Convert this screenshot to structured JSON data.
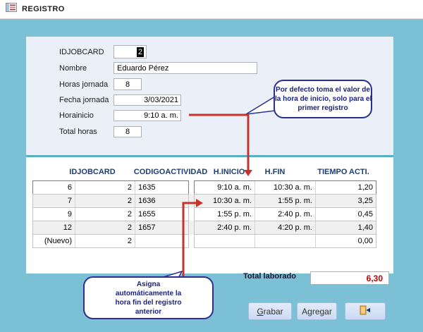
{
  "titlebar": {
    "title": "REGISTRO"
  },
  "form": {
    "fields": [
      {
        "label": "IDJOBCARD",
        "value": "2"
      },
      {
        "label": "Nombre",
        "value": "Eduardo Pérez"
      },
      {
        "label": "Horas jornada",
        "value": "8"
      },
      {
        "label": "Fecha jornada",
        "value": "3/03/2021"
      },
      {
        "label": "Horainicio",
        "value": "9:10 a. m."
      },
      {
        "label": "Total horas",
        "value": "8"
      }
    ]
  },
  "table": {
    "headers": [
      "IDJOBCARD",
      "CODIGOACTIVIDAD",
      "H.INICIO",
      "H.FIN",
      "TIEMPO ACTI."
    ],
    "rows": [
      [
        "6",
        "2",
        "1635",
        "9:10 a. m.",
        "10:30 a. m.",
        "1,20"
      ],
      [
        "7",
        "2",
        "1636",
        "10:30 a. m.",
        "1:55 p. m.",
        "3,25"
      ],
      [
        "9",
        "2",
        "1655",
        "1:55 p. m.",
        "2:40 p. m.",
        "0,45"
      ],
      [
        "12",
        "2",
        "1657",
        "2:40 p. m.",
        "4:20 p. m.",
        "1,40"
      ],
      [
        "(Nuevo)",
        "2",
        "",
        "",
        "",
        "0,00"
      ]
    ]
  },
  "callouts": {
    "top": {
      "lines": [
        "Por defecto toma el valor de",
        "la hora de inicio, solo para el",
        "primer registro"
      ]
    },
    "bottom": {
      "lines": [
        "Asigna",
        "automáticamente la",
        "hora fin del registro",
        "anterior"
      ]
    }
  },
  "footer": {
    "total_label": "Total laborado",
    "total_value": "6,30",
    "buttons": {
      "grabar": {
        "accel": "G",
        "rest": "rabar"
      },
      "agregar": {
        "label": "Agregar"
      }
    }
  },
  "icons": [
    "form-icon",
    "exit-door-icon",
    "arrow-red-annotation"
  ],
  "colors": {
    "background_teal": "#7BC0D4",
    "form_panel": "#EBF0F8",
    "divider_teal": "#57B1C5",
    "table_header_navy": "#1E3D74",
    "callout_navy": "#2B2F92",
    "arrow_red": "#C5332D",
    "total_value_red": "#C00000",
    "button_face": "#D5E0F5"
  }
}
